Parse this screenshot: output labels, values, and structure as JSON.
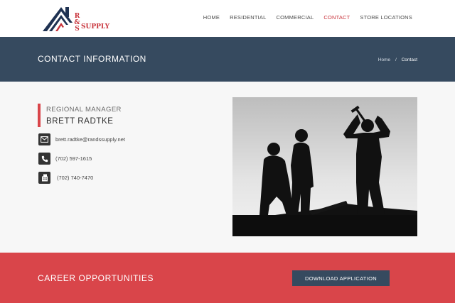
{
  "brand": {
    "letters": [
      "R",
      "&",
      "S"
    ],
    "wordmark": "SUPPLY",
    "colors": {
      "navy": "#1f3252",
      "red": "#c8323a"
    }
  },
  "nav": {
    "items": [
      {
        "label": "HOME",
        "active": false
      },
      {
        "label": "RESIDENTIAL",
        "active": false
      },
      {
        "label": "COMMERCIAL",
        "active": false
      },
      {
        "label": "CONTACT",
        "active": true
      },
      {
        "label": "STORE LOCATIONS",
        "active": false
      }
    ]
  },
  "titlebar": {
    "title": "CONTACT INFORMATION",
    "breadcrumb": {
      "home": "Home",
      "separator": "/",
      "current": "Contact"
    }
  },
  "contact": {
    "role": "REGIONAL MANAGER",
    "name": "BRETT RADTKE",
    "email": {
      "icon": "envelope-icon",
      "value": "brett.radtke@randssupply.net"
    },
    "phone": {
      "icon": "phone-icon",
      "value": "(702) 597-1615"
    },
    "fax": {
      "icon": "fax-icon",
      "value": "(702) 740-7470"
    }
  },
  "photo": {
    "subject": "silhouette of construction workers against a gray sky"
  },
  "career": {
    "title": "CAREER OPPORTUNITIES",
    "button_label": "DOWNLOAD APPLICATION"
  },
  "colors": {
    "header_bg": "#ffffff",
    "titlebar_bg": "#364a5f",
    "accent_red": "#d9454a",
    "page_bg": "#f7f7f7",
    "icon_bg": "#333333"
  }
}
